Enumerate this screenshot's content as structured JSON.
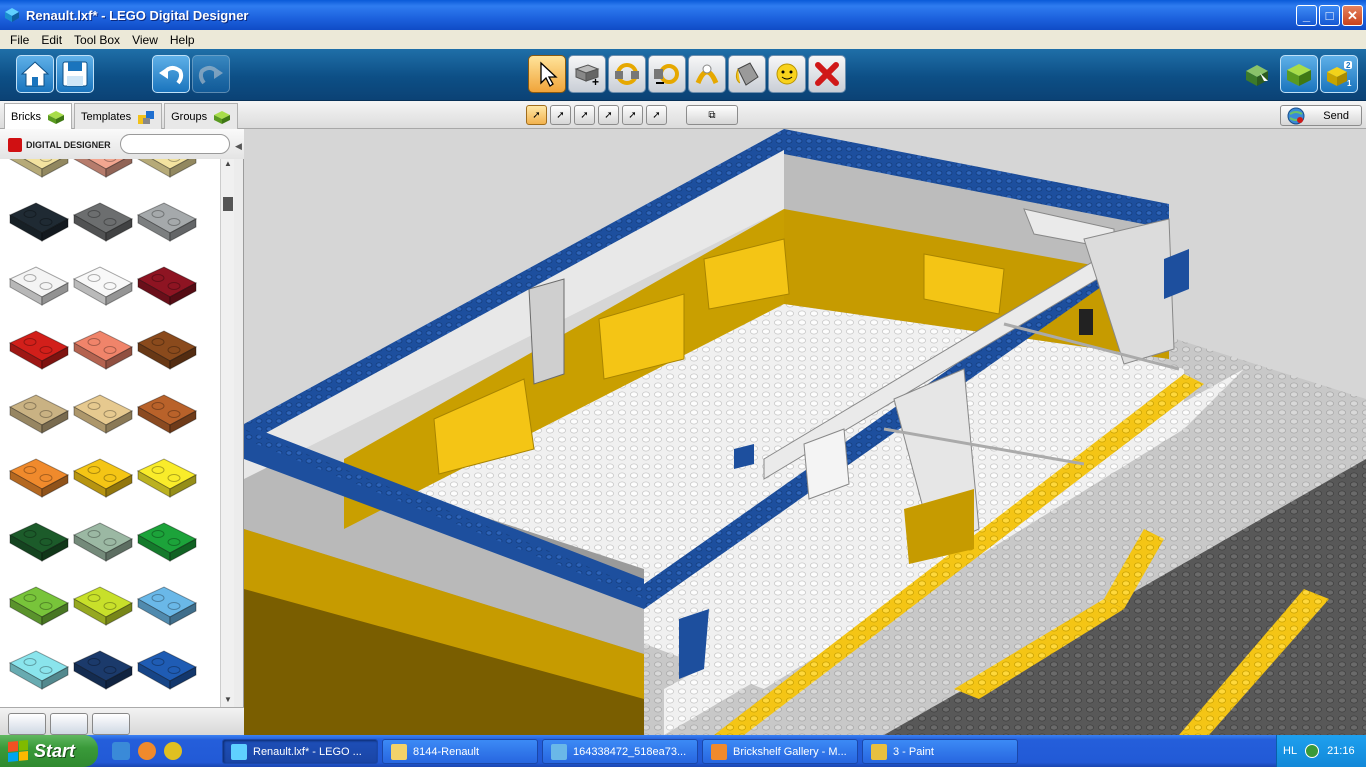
{
  "window": {
    "title": "Renault.lxf* - LEGO Digital Designer",
    "minimize": "_",
    "maximize": "□",
    "close": "✕"
  },
  "menu": [
    "File",
    "Edit",
    "Tool Box",
    "View",
    "Help"
  ],
  "toolbar": {
    "left_icons": [
      "home-icon",
      "save-icon",
      "undo-icon",
      "redo-icon"
    ],
    "tool_icons": [
      "select-arrow-icon",
      "clone-icon",
      "hinge-icon",
      "hinge-align-icon",
      "flex-icon",
      "paint-bucket-icon",
      "minifig-decorate-icon",
      "delete-icon"
    ],
    "mode_icons": [
      "build-mode-icon",
      "view-mode-icon",
      "building-guide-icon"
    ]
  },
  "palette_tabs": [
    "Bricks",
    "Templates",
    "Groups"
  ],
  "send_label": "Send",
  "palette_logo": "DIGITAL DESIGNER",
  "search": {
    "placeholder": ""
  },
  "bricks": [
    {
      "color": "#f3e3a0",
      "name": "light-yellow"
    },
    {
      "color": "#f2a690",
      "name": "light-salmon"
    },
    {
      "color": "#f3e3a0",
      "name": "light-yellow-2"
    },
    {
      "color": "#1f2a33",
      "name": "black"
    },
    {
      "color": "#6c6e6f",
      "name": "dark-stone-grey"
    },
    {
      "color": "#a5a9ab",
      "name": "medium-stone-grey"
    },
    {
      "color": "#f4f4f4",
      "name": "white"
    },
    {
      "color": "#f8f8f8",
      "name": "transparent"
    },
    {
      "color": "#8e1422",
      "name": "dark-red"
    },
    {
      "color": "#d21f1a",
      "name": "bright-red"
    },
    {
      "color": "#f0846a",
      "name": "transparent-red"
    },
    {
      "color": "#8a4a1c",
      "name": "reddish-brown"
    },
    {
      "color": "#c9b283",
      "name": "sand-yellow"
    },
    {
      "color": "#e6c98f",
      "name": "tan"
    },
    {
      "color": "#b9622a",
      "name": "dark-orange"
    },
    {
      "color": "#f08a2c",
      "name": "bright-orange"
    },
    {
      "color": "#f4c515",
      "name": "bright-yellow"
    },
    {
      "color": "#f9ec2a",
      "name": "transparent-yellow"
    },
    {
      "color": "#1c5b2a",
      "name": "dark-green"
    },
    {
      "color": "#9bb8a3",
      "name": "sand-green"
    },
    {
      "color": "#1ca33a",
      "name": "bright-green"
    },
    {
      "color": "#78c43a",
      "name": "lime-green"
    },
    {
      "color": "#c8e02a",
      "name": "bright-yellowish-green"
    },
    {
      "color": "#6ab8e8",
      "name": "medium-blue"
    },
    {
      "color": "#8ae4ec",
      "name": "light-aqua"
    },
    {
      "color": "#1b3a6b",
      "name": "earth-blue"
    },
    {
      "color": "#1f5cb4",
      "name": "bright-blue"
    }
  ],
  "taskbar": {
    "start_label": "Start",
    "tasks": [
      {
        "label": "Renault.lxf* - LEGO ...",
        "icon": "lego-designer-icon",
        "active": true
      },
      {
        "label": "8144-Renault",
        "icon": "folder-icon",
        "active": false
      },
      {
        "label": "164338472_518ea73...",
        "icon": "image-viewer-icon",
        "active": false
      },
      {
        "label": "Brickshelf Gallery - M...",
        "icon": "firefox-icon",
        "active": false
      },
      {
        "label": "3 - Paint",
        "icon": "paint-icon",
        "active": false
      }
    ],
    "lang": "HL",
    "clock": "21:16"
  },
  "colors": {
    "wall_blue": "#1d4f9e",
    "plate_white": "#f1f1f1",
    "yellow": "#f4c515",
    "dark_grey": "#5a5a5a"
  }
}
